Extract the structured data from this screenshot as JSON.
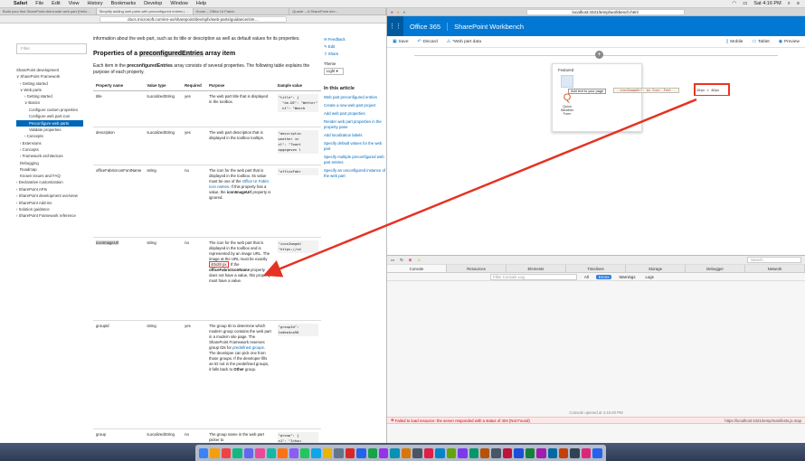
{
  "menubar": {
    "app": "Safari",
    "items": [
      "File",
      "Edit",
      "View",
      "History",
      "Bookmarks",
      "Develop",
      "Window",
      "Help"
    ],
    "clock": "Sat 4:16 PM"
  },
  "left": {
    "tabs": [
      "Build your first SharePoint client-side web part (Hello…",
      "Simplify adding web parts with preconfigured entries | …",
      "Home – Office UI Fabric",
      "Quantr – A SharePoint dev…"
    ],
    "url": "docs.microsoft.com/en-us/sharepoint/dev/spfx/web-parts/guidance/sim…",
    "filter_placeholder": "Filter",
    "nav": [
      {
        "label": "SharePoint development",
        "level": 0
      },
      {
        "label": "∨ SharePoint Framework",
        "level": 0
      },
      {
        "label": "› Getting started",
        "level": 1
      },
      {
        "label": "∨ Web parts",
        "level": 1
      },
      {
        "label": "› Getting started",
        "level": 2
      },
      {
        "label": "∨ Basics",
        "level": 2
      },
      {
        "label": "Configure custom properties",
        "level": 3,
        "wrap": true
      },
      {
        "label": "Configure web part icon",
        "level": 3,
        "wrap": true
      },
      {
        "label": "Preconfigure web parts",
        "level": 3,
        "selected": true
      },
      {
        "label": "Validate properties",
        "level": 3
      },
      {
        "label": "› Concepts",
        "level": 2
      },
      {
        "label": "› Extensions",
        "level": 1
      },
      {
        "label": "› Concepts",
        "level": 1
      },
      {
        "label": "› Framework architecture",
        "level": 1
      },
      {
        "label": "Debugging",
        "level": 1
      },
      {
        "label": "Roadmap",
        "level": 1
      },
      {
        "label": "Known issues and FAQ",
        "level": 1
      },
      {
        "label": "› Declarative customization",
        "level": 0
      },
      {
        "label": "› SharePoint APIs",
        "level": 0
      },
      {
        "label": "› SharePoint development overview",
        "level": 0,
        "wrap": true
      },
      {
        "label": "› SharePoint Add-ins",
        "level": 0
      },
      {
        "label": "› Solution guidance",
        "level": 0
      },
      {
        "label": "› SharePoint Framework reference",
        "level": 0,
        "wrap": true
      }
    ],
    "article": {
      "intro": "information about the web part, such as its title or description as well as default values for its properties.",
      "heading_pre": "Properties of a ",
      "heading_bold": "preconfiguredEntries",
      "heading_post": " array item",
      "body_pre": "Each item in the ",
      "body_bold": "preconfiguredEntries",
      "body_post": " array consists of several properties. The following table explains the purpose of each property.",
      "columns": [
        "Property name",
        "Value type",
        "Required",
        "Purpose",
        "Sample value"
      ],
      "rows": [
        {
          "name": "title",
          "type": "ILocalizedString",
          "req": "yes",
          "purpose": "The web part title that is displayed in the toolbox.",
          "sample": "\"title\": {\n  \"de-DE\": \"Wetter\"\n  n1\": \"Weerb"
        },
        {
          "name": "description",
          "type": "ILocalizedString",
          "req": "yes",
          "purpose": "The web part description that is displayed in the toolbox tooltips.",
          "sample": "\"descriptio\nweather in\nnl\": \"Toont\nopgegeven l"
        },
        {
          "name": "officeFabricIconFontName",
          "type": "string",
          "req": "no",
          "purpose_1": "The icon for the web part that is displayed in the toolbox. Its value must be one of the ",
          "purpose_link": "Office UI Fabric icon names",
          "purpose_2": ". If this property has a value, the ",
          "purpose_bold": "iconImageUrl",
          "purpose_3": " property is ignored.",
          "sample": "\"officeFabr"
        },
        {
          "name": "iconImageUrl",
          "type": "string",
          "req": "no",
          "purpose_1": "The icon for the web part that is displayed in the toolbox and is represented by an image URL. The image at the URL must be exactly ",
          "purpose_box": "40x28 px",
          "purpose_2": ". If the ",
          "purpose_bold": "officeFabricIconName",
          "purpose_3": " property does not have a value, this property must have a value.",
          "sample": "\"iconImageU\n\"https://cd"
        },
        {
          "name": "groupId",
          "type": "string",
          "req": "yes",
          "purpose_1": "The group ID to determine which modern group contains the web part in a modern site page. The SharePoint Framework reserves group IDs for ",
          "purpose_link": "predefined groups",
          "purpose_2": ". The developer can pick one from those groups. If the developer fills an ID not in the predefined groups, it falls back to ",
          "purpose_bold": "Other",
          "purpose_3": " group.",
          "sample": "\"groupId\":\n1edbe4ca96"
        },
        {
          "name": "group",
          "type": "ILocalizedString",
          "req": "no",
          "purpose": "The group name in the web part picker to",
          "sample": "\"group\": {\nn1\": \"Inhou"
        }
      ]
    },
    "rail": {
      "links": [
        "Feedback",
        "Edit",
        "Share"
      ],
      "theme_label": "Theme",
      "theme_value": "Light",
      "in_article": "In this article",
      "article_links": [
        "Web part preconfigured entries",
        "Create a new web part project",
        "Add web part properties",
        "Render web part properties in the property pane",
        "Add localization labels",
        "Specify default values for the web part",
        "Specify multiple preconfigured web part entries",
        "Specify an unconfigured instance of the web part"
      ]
    }
  },
  "right": {
    "url": "localhost:4321/temp/workbench.html",
    "brand": "Office 365",
    "app": "SharePoint Workbench",
    "cmd": {
      "save": "Save",
      "discard": "Discard",
      "status": "*Web part data",
      "mobile": "Mobile",
      "tablet": "Tablet",
      "preview": "Preview"
    },
    "toolbox": {
      "category": "Featured",
      "items": [
        "Add text to your page",
        "Quick Weather Form"
      ],
      "tooltip": "Add text to your page",
      "code": "--iconImageUrl: ms-Icon--Font...",
      "red_label": "28px × 40px"
    },
    "devtools": {
      "search": "Search",
      "tabs": [
        "Console",
        "Resources",
        "Elements",
        "Timelines",
        "Storage",
        "Debugger",
        "Network"
      ],
      "filter_placeholder": "Filter Console Log",
      "levels": [
        "All",
        "Errors",
        "Warnings",
        "Logs"
      ],
      "opened": "Console opened at 4:15:40 PM",
      "error": "Failed to load resource: the server responded with a status of 404 (Not Found)",
      "error_source": "https://localhost:4321/temp/manifests.js.map"
    }
  },
  "dock": {
    "colors": [
      "#3b82f6",
      "#f59e0b",
      "#ef4444",
      "#10b981",
      "#6366f1",
      "#ec4899",
      "#14b8a6",
      "#f97316",
      "#8b5cf6",
      "#22c55e",
      "#0ea5e9",
      "#eab308",
      "#64748b",
      "#dc2626",
      "#2563eb",
      "#16a34a",
      "#9333ea",
      "#0891b2",
      "#d97706",
      "#4b5563",
      "#e11d48",
      "#0284c7",
      "#65a30d",
      "#7c3aed",
      "#059669",
      "#b45309",
      "#475569",
      "#be123c",
      "#1d4ed8",
      "#15803d",
      "#a21caf",
      "#0369a1",
      "#c2410c",
      "#334155",
      "#db2777",
      "#2563eb"
    ]
  },
  "accent": "#0078d4",
  "annotation_color": "#e53222"
}
